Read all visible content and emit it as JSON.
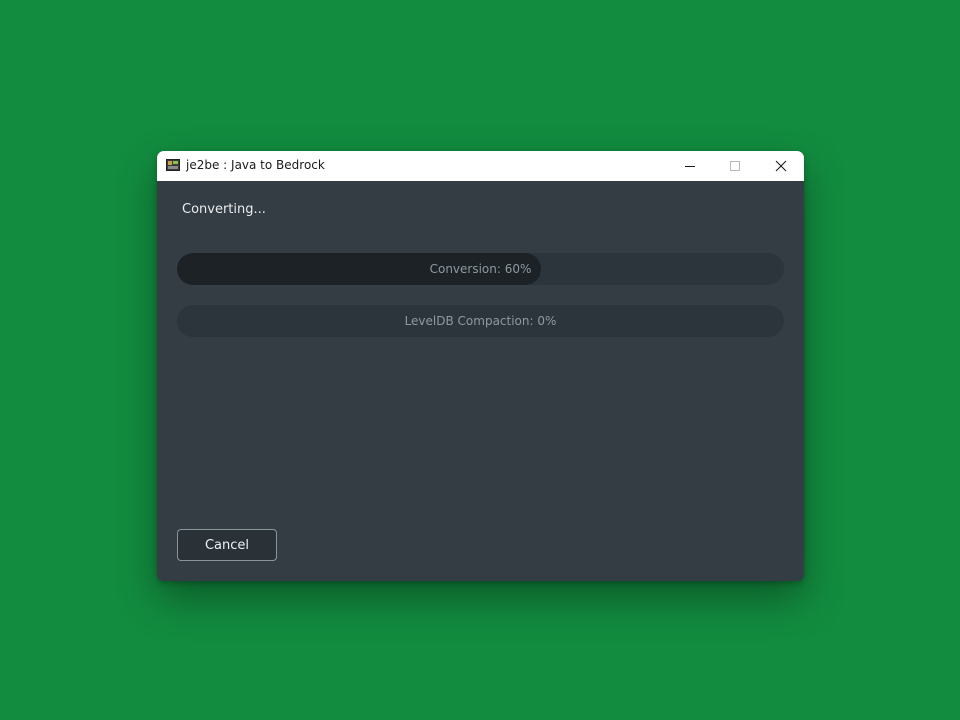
{
  "window": {
    "title": "je2be : Java to Bedrock",
    "icon": "app-icon"
  },
  "titlebar": {
    "minimize_icon": "minimize-icon",
    "maximize_icon": "maximize-icon",
    "close_icon": "close-icon"
  },
  "dialog": {
    "status_text": "Converting...",
    "progress_conversion": {
      "label": "Conversion: 60%",
      "value": 0.6
    },
    "progress_compaction": {
      "label": "LevelDB Compaction: 0%",
      "value": 0.0
    },
    "cancel_label": "Cancel"
  },
  "colors": {
    "desktop_background": "#128c3f",
    "window_background": "#343d43",
    "progress_track": "#2c353b",
    "progress_fill": "#1c2226",
    "titlebar": "#ffffff"
  }
}
